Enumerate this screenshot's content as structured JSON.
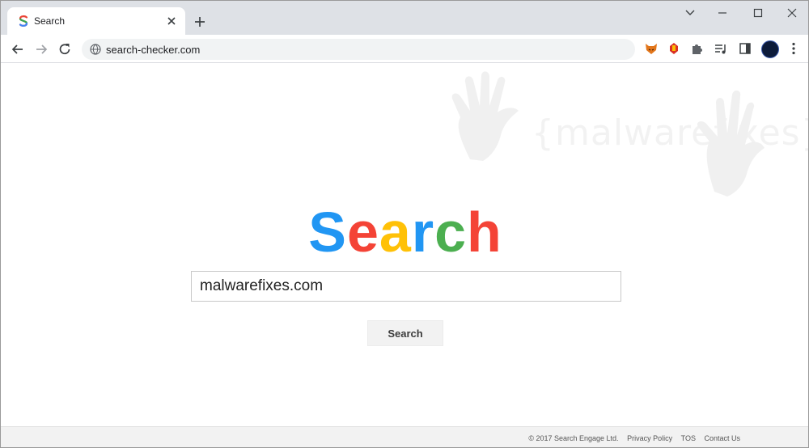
{
  "browser": {
    "tab": {
      "title": "Search",
      "favicon_letter": "S",
      "favicon_color": "#ea4335"
    },
    "address": {
      "url": "search-checker.com"
    },
    "extensions": [
      "fox-extension-icon",
      "alert-extension-icon",
      "puzzle-icon",
      "playlist-icon",
      "sidepanel-icon"
    ]
  },
  "watermark": {
    "text": "{malwarefixes}"
  },
  "logo": {
    "letters": [
      {
        "char": "S",
        "color": "#2196f3"
      },
      {
        "char": "e",
        "color": "#f44336"
      },
      {
        "char": "a",
        "color": "#ffc107"
      },
      {
        "char": "r",
        "color": "#2196f3"
      },
      {
        "char": "c",
        "color": "#4caf50"
      },
      {
        "char": "h",
        "color": "#f44336"
      }
    ]
  },
  "search": {
    "value": "malwarefixes.com",
    "button_label": "Search"
  },
  "footer": {
    "copyright": "© 2017 Search Engage Ltd.",
    "privacy": "Privacy Policy",
    "tos": "TOS",
    "contact": "Contact Us"
  }
}
